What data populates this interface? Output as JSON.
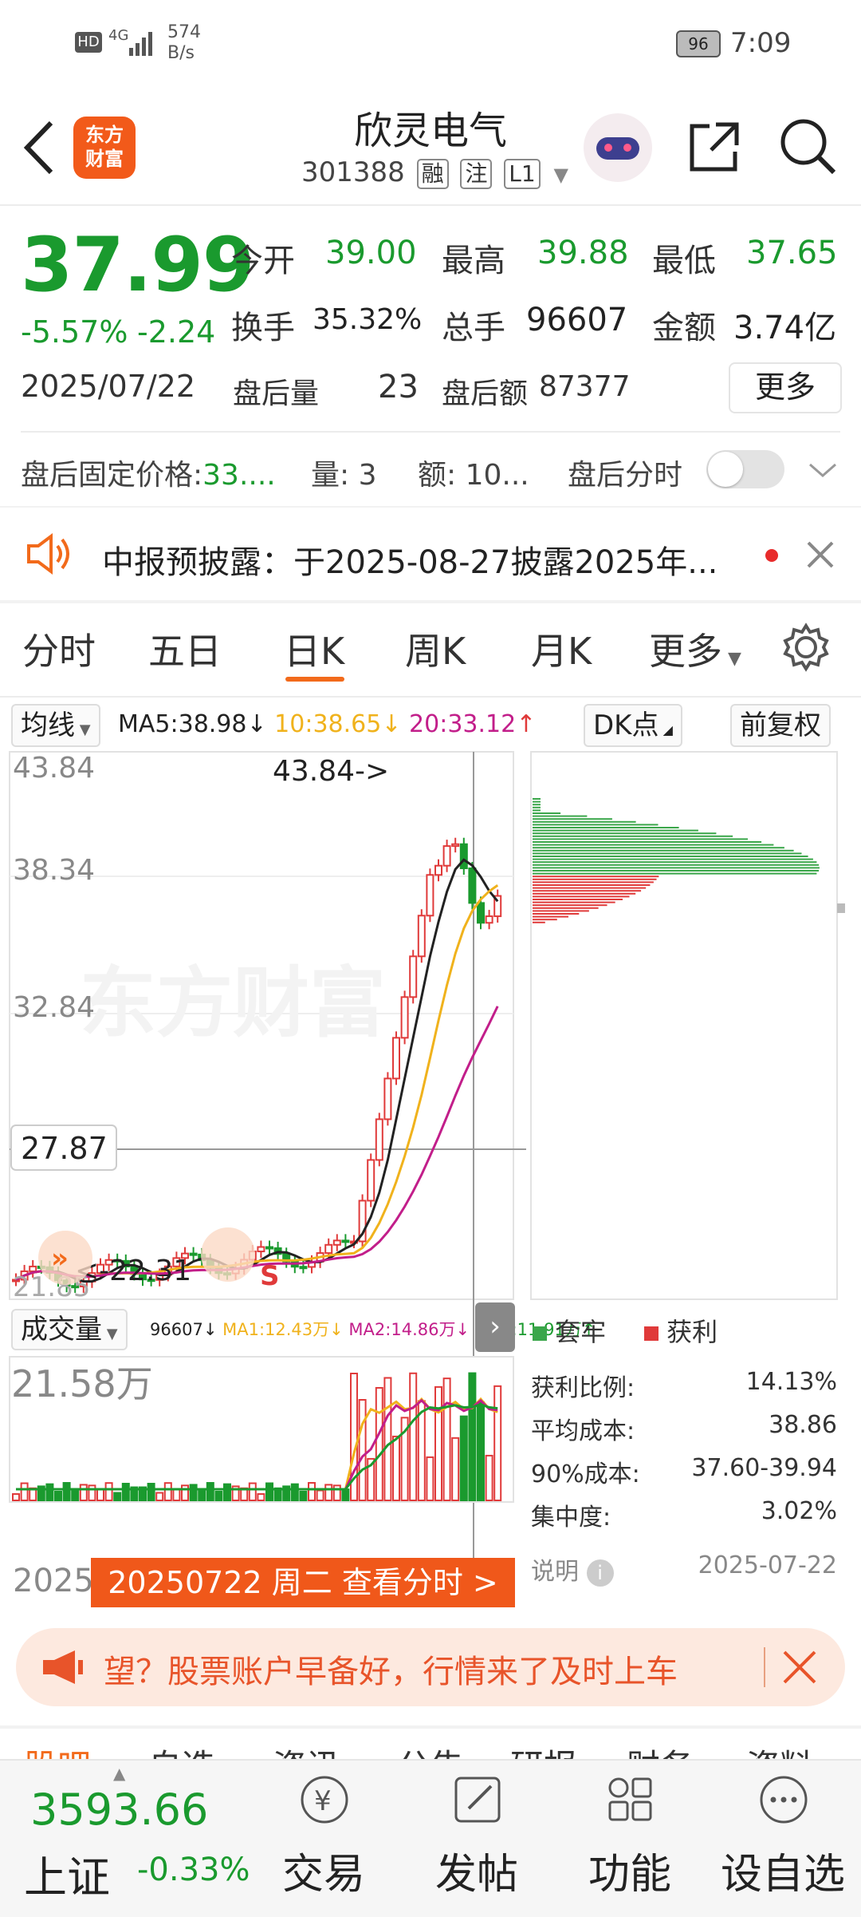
{
  "status_bar": {
    "hd": "HD",
    "net": "4G",
    "speed_num": "574",
    "speed_unit": "B/s",
    "battery": "96",
    "time": "7:09"
  },
  "header": {
    "logo_line1": "东方",
    "logo_line2": "财富",
    "title": "欣灵电气",
    "code": "301388",
    "tags": [
      "融",
      "注",
      "L1"
    ]
  },
  "quote": {
    "price": "37.99",
    "change_pct": "-5.57%",
    "change": "-2.24",
    "date": "2025/07/22",
    "open_label": "今开",
    "open": "39.00",
    "high_label": "最高",
    "high": "39.88",
    "low_label": "最低",
    "low": "37.65",
    "turnover_label": "换手",
    "turnover": "35.32%",
    "volume_label": "总手",
    "volume": "96607",
    "amount_label": "金额",
    "amount": "3.74亿",
    "after_vol_label": "盘后量",
    "after_vol": "23",
    "after_amt_label": "盘后额",
    "after_amt": "87377",
    "more_label": "更多"
  },
  "after_hours": {
    "price_label": "盘后固定价格:",
    "price": "33....",
    "qty_label": "量:",
    "qty": "3",
    "amt_label": "额:",
    "amt": "10...",
    "toggle_label": "盘后分时",
    "toggle_on": false
  },
  "notice": {
    "text": "中报预披露：于2025-08-27披露2025年..."
  },
  "tabs": [
    {
      "label": "分时",
      "active": false
    },
    {
      "label": "五日",
      "active": false
    },
    {
      "label": "日K",
      "active": true
    },
    {
      "label": "周K",
      "active": false
    },
    {
      "label": "月K",
      "active": false
    },
    {
      "label": "更多",
      "active": false
    }
  ],
  "ma_bar": {
    "selector": "均线",
    "ma5": "MA5:38.98",
    "ma10": "10:38.65",
    "ma20": "20:33.12",
    "dk": "DK点",
    "adjust": "前复权"
  },
  "kline": {
    "y_labels": [
      "43.84",
      "38.34",
      "32.84",
      "27.87",
      "21.85"
    ],
    "high_marker": "43.84->",
    "low_marker": "<-22.31",
    "signal": "S",
    "watermark": "东方财富"
  },
  "volume_bar": {
    "selector": "成交量",
    "vol": "96607",
    "ma1": "MA1:12.43万",
    "ma2": "MA2:14.86万",
    "ma3": "MA3:11.91万",
    "max_label": "21.58万"
  },
  "date_footer": {
    "start": "2025",
    "hint": "20250722 周二 查看分时 >"
  },
  "distribution": {
    "legend_trap": "套牢",
    "legend_profit": "获利",
    "rows": [
      {
        "label": "获利比例:",
        "value": "14.13%"
      },
      {
        "label": "平均成本:",
        "value": "38.86"
      },
      {
        "label": "90%成本:",
        "value": "37.60-39.94"
      },
      {
        "label": "集中度:",
        "value": "3.02%"
      }
    ],
    "note_label": "说明",
    "date": "2025-07-22"
  },
  "banner": {
    "text": "望？股票账户早备好，行情来了及时上车"
  },
  "section_tabs_partial": [
    "股吧",
    "自选",
    "资讯",
    "公告",
    "研报",
    "财务",
    "资料"
  ],
  "bottom": {
    "index_value": "3593.66",
    "index_name": "上证",
    "index_change": "-0.33%",
    "nav": [
      {
        "label": "交易"
      },
      {
        "label": "发帖"
      },
      {
        "label": "功能"
      },
      {
        "label": "设自选"
      }
    ]
  },
  "colors": {
    "up": "#e03a3a",
    "down": "#1a9a2e",
    "accent": "#f26a1b",
    "ma5": "#222222",
    "ma10": "#f0b21c",
    "ma20": "#c21e8a"
  }
}
